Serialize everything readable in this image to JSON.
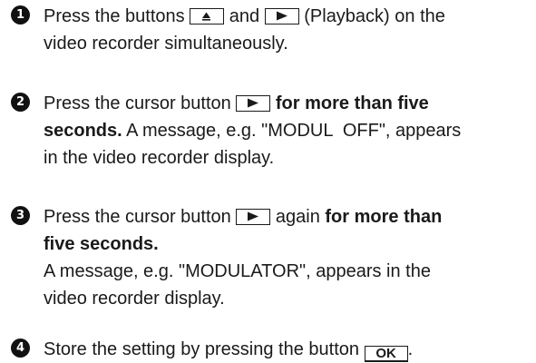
{
  "steps": [
    {
      "number": "1",
      "lines": [
        {
          "t1": "Press the buttons ",
          "t2": " and ",
          "t3": " (Playback) on the"
        },
        {
          "t1": "video recorder simultaneously."
        }
      ],
      "keys": [
        "eject-key",
        "play-key"
      ]
    },
    {
      "number": "2",
      "lines": [
        {
          "t1": "Press the cursor button ",
          "b1": " for more than five"
        },
        {
          "b1": "seconds.",
          "t1": " A message, e.g. \"MODUL  OFF\", appears"
        },
        {
          "t1": "in the video recorder display."
        }
      ],
      "keys": [
        "play-key"
      ]
    },
    {
      "number": "3",
      "lines": [
        {
          "t1": "Press the cursor button ",
          "t2": " again ",
          "b1": "for more than"
        },
        {
          "b1": "five seconds."
        },
        {
          "t1": "A message, e.g. \"MODULATOR\", appears in the"
        },
        {
          "t1": "video recorder display."
        }
      ],
      "keys": [
        "play-key"
      ]
    },
    {
      "number": "4",
      "lines": [
        {
          "t1": "Store the setting by pressing the button ",
          "t2": "."
        }
      ],
      "keys": [
        "ok-key"
      ],
      "ok_label": "OK"
    }
  ],
  "icons": {
    "eject": "eject-icon",
    "play": "play-icon"
  },
  "colors": {
    "text": "#1a1a1a",
    "badge_bg": "#111111",
    "badge_fg": "#ffffff"
  }
}
